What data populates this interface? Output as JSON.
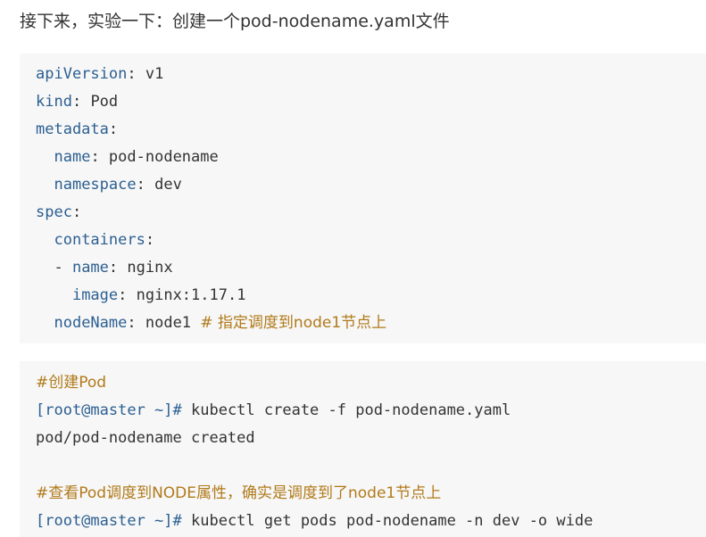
{
  "intro": {
    "text": "接下来，实验一下：创建一个pod-nodename.yaml文件"
  },
  "yaml": {
    "lines": [
      {
        "indent": "",
        "key": "apiVersion",
        "sep": ": ",
        "value": "v1",
        "comment": ""
      },
      {
        "indent": "",
        "key": "kind",
        "sep": ": ",
        "value": "Pod",
        "comment": ""
      },
      {
        "indent": "",
        "key": "metadata",
        "sep": ":",
        "value": "",
        "comment": ""
      },
      {
        "indent": "  ",
        "key": "name",
        "sep": ": ",
        "value": "pod-nodename",
        "comment": ""
      },
      {
        "indent": "  ",
        "key": "namespace",
        "sep": ": ",
        "value": "dev",
        "comment": ""
      },
      {
        "indent": "",
        "key": "spec",
        "sep": ":",
        "value": "",
        "comment": ""
      },
      {
        "indent": "  ",
        "key": "containers",
        "sep": ":",
        "value": "",
        "comment": ""
      },
      {
        "indent": "  - ",
        "key": "name",
        "sep": ": ",
        "value": "nginx",
        "comment": ""
      },
      {
        "indent": "    ",
        "key": "image",
        "sep": ": ",
        "value": "nginx:1.17.1",
        "comment": ""
      },
      {
        "indent": "  ",
        "key": "nodeName",
        "sep": ": ",
        "value": "node1 ",
        "comment": "# 指定调度到node1节点上"
      }
    ]
  },
  "shell": {
    "comment1": "#创建Pod",
    "prompt1": "[root@master ~]#",
    "command1": " kubectl create -f pod-nodename.yaml",
    "output1": "pod/pod-nodename created",
    "comment2": "#查看Pod调度到NODE属性，确实是调度到了node1节点上",
    "prompt2": "[root@master ~]#",
    "command2": " kubectl get pods pod-nodename -n dev -o wide"
  }
}
